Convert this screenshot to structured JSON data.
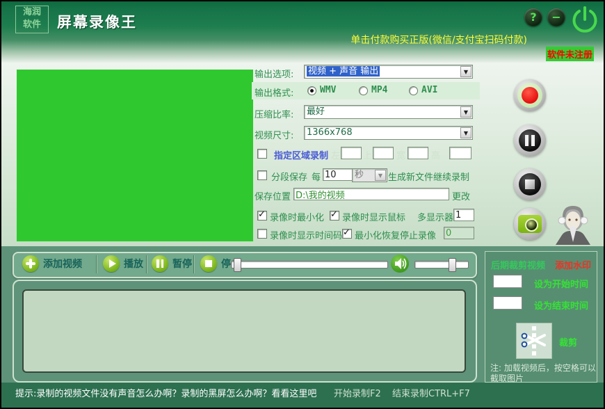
{
  "window": {
    "logo_line1": "海润",
    "logo_line2": "软件",
    "title": "屏幕录像王"
  },
  "header": {
    "help_glyph": "?",
    "minimize_glyph": "−",
    "buy_text": "单击付款购买正版(微信/支付宝扫码付款)",
    "unregistered": "软件未注册"
  },
  "form": {
    "output_option_label": "输出选项:",
    "output_option_value": "视频 + 声音 输出",
    "output_format_label": "输出格式:",
    "formats": [
      {
        "label": "WMV"
      },
      {
        "label": "MP4"
      },
      {
        "label": "AVI"
      }
    ],
    "compression_label": "压缩比率:",
    "compression_value": "最好",
    "video_size_label": "视频尺寸:",
    "video_size_value": "1366x768",
    "region_label": "指定区域录制",
    "region_fields": [
      "左",
      "上",
      "宽",
      "高"
    ],
    "segment_label": "分段保存",
    "segment_every": "每",
    "segment_value": "10",
    "segment_unit": "秒",
    "segment_suffix": "生成新文件继续录制",
    "save_label": "保存位置",
    "save_path": "D:\\我的视频",
    "change_label": "更改",
    "minimize_rec_label": "录像时最小化",
    "mouse_label": "录像时显示鼠标",
    "multi_label": "多显示器",
    "multi_value": "1",
    "timecode_label": "录像时显示时间码",
    "restore_label": "最小化恢复停止录像",
    "restore_value": "0",
    "dropdown_arrow_glyph": "▼"
  },
  "toolbar": {
    "add_label": "添加视频",
    "play_label": "播放",
    "pause_label": "暂停",
    "stop_label": "停止"
  },
  "crop_panel": {
    "title": "后期裁剪视频",
    "watermark_label": "添加水印",
    "set_start_label": "设为开始时间",
    "set_end_label": "设为结束时间",
    "crop_label": "裁剪",
    "note_line1": "注: 加载视频后，按空格可以",
    "note_line2": "截取图片"
  },
  "statusbar": {
    "tip": "提示:录制的视频文件没有声音怎么办啊？录制的黑屏怎么办啊？看看这里吧",
    "start_hotkey": "开始录制F2",
    "end_hotkey": "结束录制CTRL+F7"
  },
  "colors": {
    "preview_green": "#2fc92f",
    "record_red": "#ea1010",
    "buy_yellow": "#fdfd38",
    "unregistered_red": "#ff0000",
    "unregistered_bg": "#33cc33",
    "selection_blue": "#2f62c9",
    "panel_green": "#578e72",
    "statusbar_green": "#2d7050"
  }
}
